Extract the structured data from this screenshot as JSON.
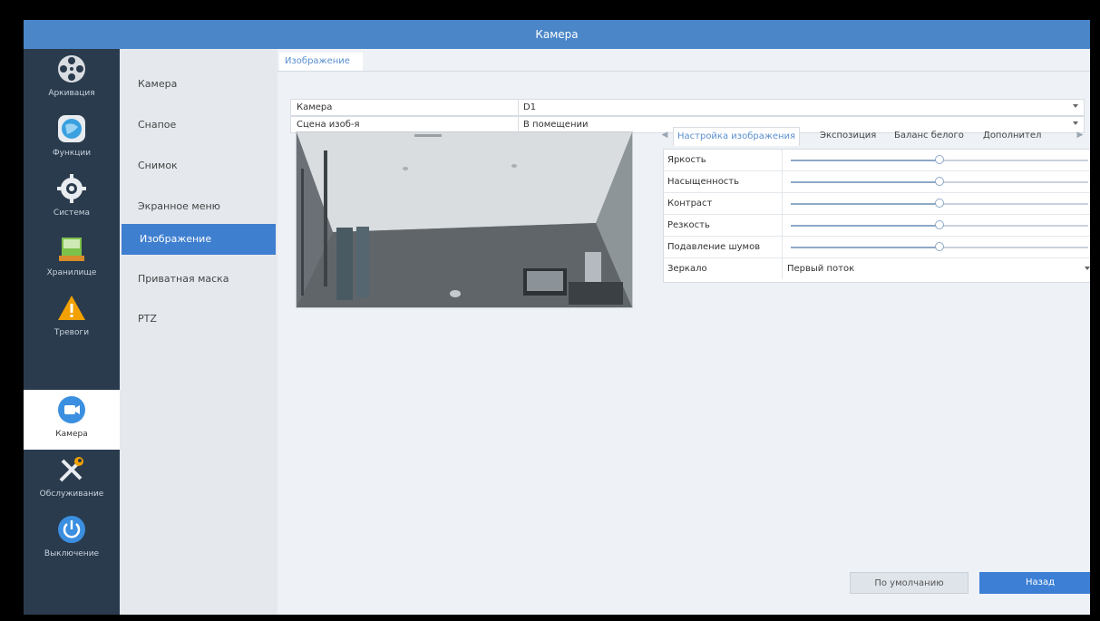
{
  "window": {
    "title": "Камера"
  },
  "rail": {
    "items": [
      {
        "label": "Аркивация",
        "icon": "film-reel-icon",
        "color": "#d9dde2"
      },
      {
        "label": "Функции",
        "icon": "globe-icon",
        "color": "#3aa0e0"
      },
      {
        "label": "Система",
        "icon": "gear-icon",
        "color": "#e8ecf0"
      },
      {
        "label": "Хранилище",
        "icon": "storage-icon",
        "color": "#7cc24a"
      },
      {
        "label": "Тревоги",
        "icon": "warning-icon",
        "color": "#f2a100"
      },
      {
        "label": "Камера",
        "icon": "camera-icon",
        "color": "#3b8fe0",
        "active": true
      },
      {
        "label": "Обслуживание",
        "icon": "tools-icon",
        "color": "#e8ecf0"
      },
      {
        "label": "Выключение",
        "icon": "power-icon",
        "color": "#3b8fe0"
      }
    ]
  },
  "submenu": {
    "items": [
      {
        "label": "Камера"
      },
      {
        "label": "Снапое"
      },
      {
        "label": "Снимок"
      },
      {
        "label": "Экранное меню"
      },
      {
        "label": "Изображение",
        "active": true
      },
      {
        "label": "Приватная маска"
      },
      {
        "label": "PTZ"
      }
    ]
  },
  "main": {
    "tab": "Изображение",
    "fields": {
      "camera": {
        "label": "Камера",
        "value": "D1"
      },
      "scene": {
        "label": "Сцена изоб-я",
        "value": "В помещении"
      }
    },
    "subtabs": [
      "Настройка изображения",
      "Экспозиция",
      "Баланс белого",
      "Дополнител"
    ],
    "params": [
      {
        "label": "Яркость",
        "level": 0.5
      },
      {
        "label": "Насыщенность",
        "level": 0.5
      },
      {
        "label": "Контраст",
        "level": 0.5
      },
      {
        "label": "Резкость",
        "level": 0.5
      },
      {
        "label": "Подавление шумов",
        "level": 0.5
      }
    ],
    "mirror": {
      "label": "Зеркало",
      "value": "Первый поток"
    },
    "buttons": {
      "default": "По умолчанию",
      "back": "Назад"
    }
  },
  "colors": {
    "accent": "#3f7fd0",
    "titlebar": "#4a86c8",
    "rail": "#2a3b4d"
  }
}
